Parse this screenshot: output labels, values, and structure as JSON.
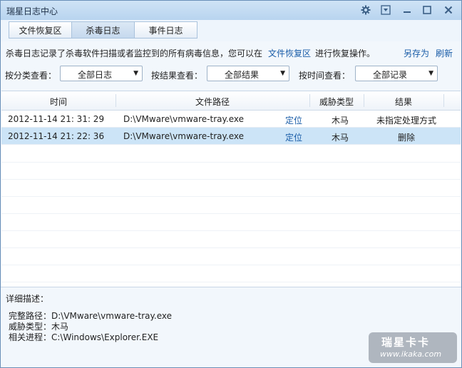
{
  "window": {
    "title": "瑞星日志中心"
  },
  "tabs": [
    {
      "label": "文件恢复区",
      "active": false
    },
    {
      "label": "杀毒日志",
      "active": true
    },
    {
      "label": "事件日志",
      "active": false
    }
  ],
  "infobar": {
    "text_before": "杀毒日志记录了杀毒软件扫描或者监控到的所有病毒信息，您可以在",
    "link": "文件恢复区",
    "text_after": "进行恢复操作。",
    "save_as": "另存为",
    "refresh": "刷新"
  },
  "filters": {
    "category_label": "按分类查看：",
    "category_value": "全部日志",
    "result_label": "按结果查看：",
    "result_value": "全部结果",
    "time_label": "按时间查看：",
    "time_value": "全部记录"
  },
  "table": {
    "columns": [
      "时间",
      "文件路径",
      "威胁类型",
      "结果"
    ],
    "rows": [
      {
        "time": "2012-11-14 21: 31: 29",
        "path": "D:\\VMware\\vmware-tray.exe",
        "locate": "定位",
        "threat": "木马",
        "result": "未指定处理方式",
        "selected": false
      },
      {
        "time": "2012-11-14 21: 22: 36",
        "path": "D:\\VMware\\vmware-tray.exe",
        "locate": "定位",
        "threat": "木马",
        "result": "删除",
        "selected": true
      }
    ]
  },
  "detail": {
    "heading": "详细描述：",
    "full_path": "完整路径：D:\\VMware\\vmware-tray.exe",
    "threat_type": "威胁类型：木马",
    "process": "相关进程：C:\\Windows\\Explorer.EXE"
  },
  "watermark": {
    "brand": "瑞星卡卡",
    "url": "www.ikaka.com"
  },
  "colors": {
    "link": "#1a5da8",
    "selected_row": "#cce4f7",
    "titlebar": "#b8d4ef"
  }
}
